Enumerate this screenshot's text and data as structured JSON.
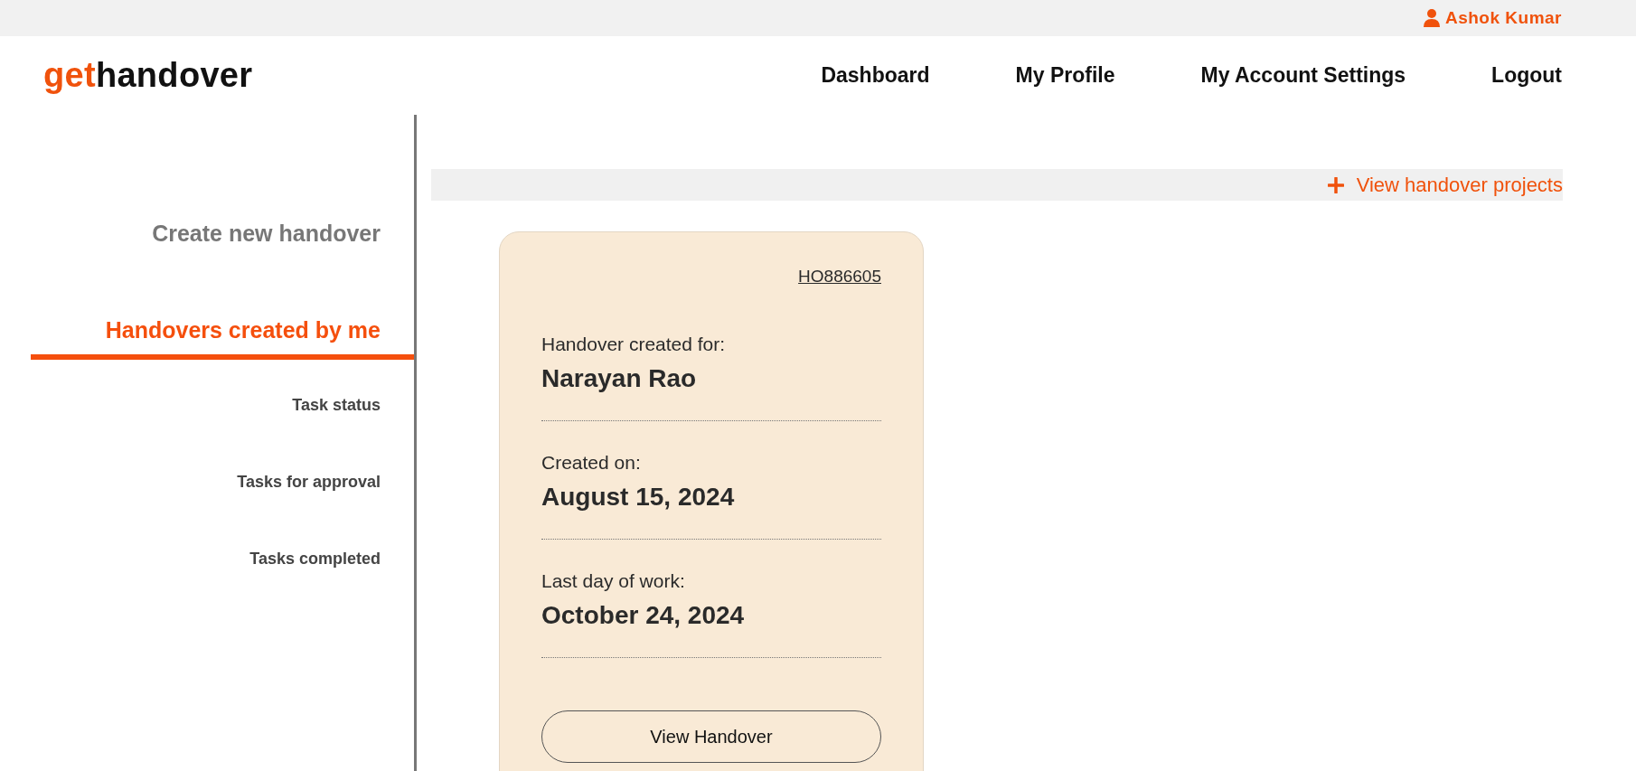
{
  "top_bar": {
    "user_name": "Ashok Kumar"
  },
  "logo": {
    "accent": "get",
    "rest": "handover"
  },
  "nav": [
    {
      "label": "Dashboard"
    },
    {
      "label": "My Profile"
    },
    {
      "label": "My Account Settings"
    },
    {
      "label": "Logout"
    }
  ],
  "sidebar": {
    "items": [
      {
        "label": "Create new handover",
        "kind": "primary",
        "selected": false
      },
      {
        "label": "Handovers created by me",
        "kind": "primary",
        "selected": true
      },
      {
        "label": "Task status",
        "kind": "sub",
        "selected": false
      },
      {
        "label": "Tasks for approval",
        "kind": "sub",
        "selected": false
      },
      {
        "label": "Tasks completed",
        "kind": "sub",
        "selected": false
      }
    ]
  },
  "action_bar": {
    "link": "View handover projects"
  },
  "cards": [
    {
      "id": "HO886605",
      "fields": [
        {
          "label": "Handover created for:",
          "value": "Narayan Rao"
        },
        {
          "label": "Created on:",
          "value": "August 15, 2024"
        },
        {
          "label": "Last day of work:",
          "value": "October 24, 2024"
        }
      ],
      "button": "View Handover"
    }
  ]
}
